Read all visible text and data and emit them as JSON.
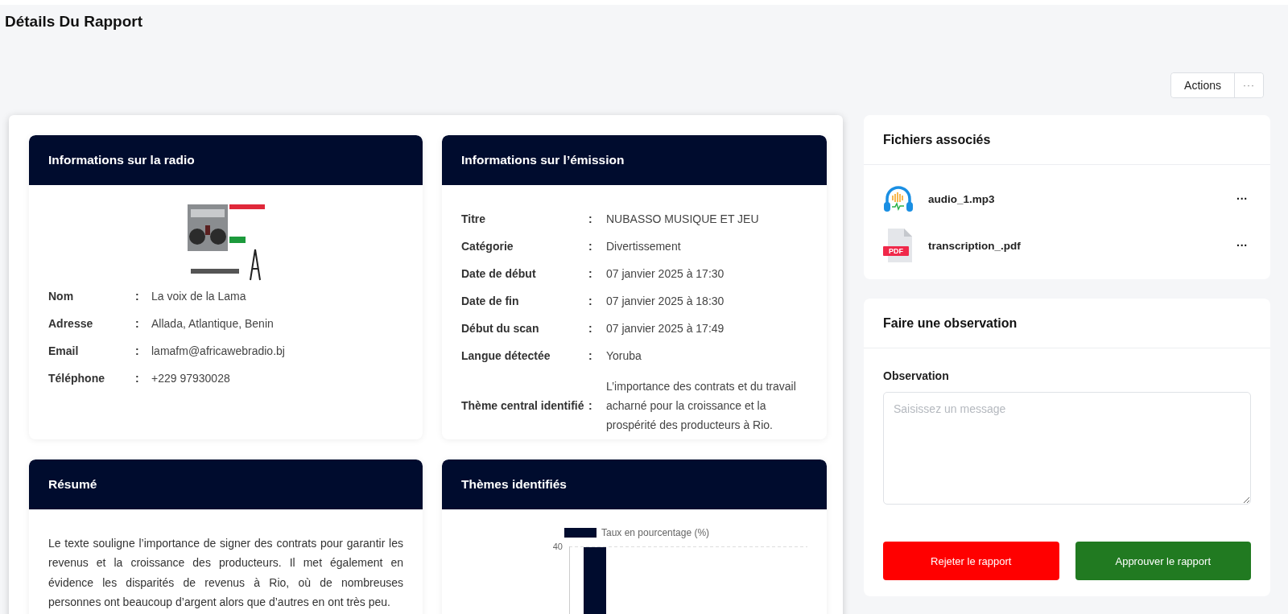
{
  "page_title": "Détails Du Rapport",
  "actions": {
    "label": "Actions",
    "more": "···"
  },
  "radio_card": {
    "title": "Informations sur la radio",
    "rows": [
      {
        "label": "Nom",
        "separator": ":",
        "value": "La voix de la Lama"
      },
      {
        "label": "Adresse",
        "separator": ":",
        "value": "Allada, Atlantique, Benin"
      },
      {
        "label": "Email",
        "separator": ":",
        "value": "lamafm@africawebradio.bj"
      },
      {
        "label": "Téléphone",
        "separator": ":",
        "value": "+229 97930028"
      }
    ]
  },
  "emission_card": {
    "title": "Informations sur l’émission",
    "rows": [
      {
        "label": "Titre",
        "separator": ":",
        "value": "NUBASSO MUSIQUE ET JEU"
      },
      {
        "label": "Catégorie",
        "separator": ":",
        "value": "Divertissement"
      },
      {
        "label": "Date de début",
        "separator": ":",
        "value": "07 janvier 2025 à 17:30"
      },
      {
        "label": "Date de fin",
        "separator": ":",
        "value": "07 janvier 2025 à 18:30"
      },
      {
        "label": "Début du scan",
        "separator": ":",
        "value": "07 janvier 2025 à 17:49"
      },
      {
        "label": "Langue détectée",
        "separator": ":",
        "value": "Yoruba"
      },
      {
        "label": "Thème central identifié",
        "separator": ":",
        "value": "L’importance des contrats et du travail acharné pour la croissance et la prospérité des producteurs à Rio."
      }
    ]
  },
  "summary_card": {
    "title": "Résumé",
    "text": "Le texte souligne l’importance de signer des contrats pour garantir les revenus et la croissance des producteurs. Il met également en évidence les disparités de revenus à Rio, où de nombreuses personnes ont beaucoup d’argent alors que d’autres en ont très peu."
  },
  "themes_card": {
    "title": "Thèmes identifiés",
    "legend": "Taux en pourcentage (%)",
    "y_tick": "40"
  },
  "files_card": {
    "title": "Fichiers associés",
    "files": [
      {
        "kind": "audio",
        "name": "audio_1.mp3",
        "menu": "···"
      },
      {
        "kind": "pdf",
        "name": "transcription_.pdf",
        "badge": "PDF",
        "menu": "···"
      }
    ]
  },
  "observation_card": {
    "title": "Faire une observation",
    "field_label": "Observation",
    "placeholder": "Saisissez un message",
    "buttons": [
      {
        "kind": "reject",
        "label": "Rejeter le rapport"
      },
      {
        "kind": "approve",
        "label": "Approuver le rapport"
      }
    ]
  }
}
